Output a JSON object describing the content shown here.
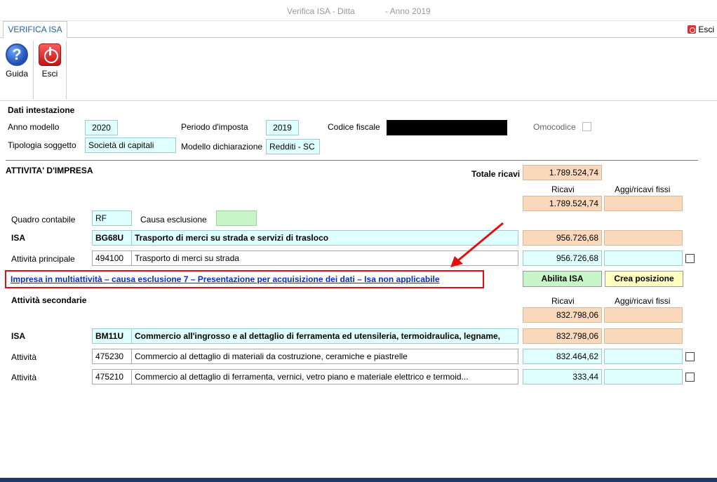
{
  "window": {
    "title_left": "Verifica ISA - Ditta",
    "title_right": "- Anno 2019"
  },
  "tabbar": {
    "tab": "VERIFICA ISA",
    "exit": "Esci"
  },
  "ribbon": {
    "help": "Guida",
    "exit": "Esci"
  },
  "header": {
    "section": "Dati intestazione",
    "anno_modello_label": "Anno modello",
    "anno_modello": "2020",
    "periodo_label": "Periodo d'imposta",
    "periodo": "2019",
    "codice_fiscale_label": "Codice fiscale",
    "codice_fiscale": "",
    "omocodice_label": "Omocodice",
    "tipologia_label": "Tipologia soggetto",
    "tipologia": "Società di capitali",
    "modello_label": "Modello dichiarazione",
    "modello": "Redditi - SC"
  },
  "impresa": {
    "section": "ATTIVITA' D'IMPRESA",
    "totale_label": "Totale ricavi",
    "totale": "1.789.524,74",
    "ricavi_header": "Ricavi",
    "aggi_header": "Aggi/ricavi fissi",
    "ricavi": "1.789.524,74",
    "aggi": "",
    "quadro_label": "Quadro contabile",
    "quadro": "RF",
    "causa_label": "Causa esclusione",
    "causa": "",
    "isa_label": "ISA",
    "isa_code": "BG68U",
    "isa_desc": "Trasporto di merci su strada e servizi di trasloco",
    "isa_ricavi": "956.726,68",
    "principale_label": "Attività principale",
    "principale_code": "494100",
    "principale_desc": "Trasporto di merci su strada",
    "principale_ricavi": "956.726,68",
    "warning": "Impresa in multiattività – causa esclusione 7 – Presentazione per acquisizione dei dati – Isa non applicabile",
    "btn_abilita": "Abilita ISA",
    "btn_crea": "Crea posizione"
  },
  "secondarie": {
    "section": "Attività secondarie",
    "ricavi_header": "Ricavi",
    "aggi_header": "Aggi/ricavi fissi",
    "ricavi": "832.798,06",
    "isa_label": "ISA",
    "isa_code": "BM11U",
    "isa_desc": "Commercio all'ingrosso e al dettaglio di ferramenta ed utensileria, termoidraulica, legname,",
    "isa_ricavi": "832.798,06",
    "rows": [
      {
        "label": "Attività",
        "code": "475230",
        "desc": "Commercio al dettaglio di materiali da costruzione, ceramiche e piastrelle",
        "ricavi": "832.464,62"
      },
      {
        "label": "Attività",
        "code": "475210",
        "desc": "Commercio al dettaglio di ferramenta, vernici, vetro piano e materiale elettrico e termoid...",
        "ricavi": "333,44"
      }
    ]
  },
  "colors": {
    "peach": "#fad8bc",
    "cyan": "#e0ffff",
    "green": "#c8f5c8",
    "yellow": "#ffffc0",
    "warning_border": "#e01010",
    "link": "#0a2fb8"
  }
}
